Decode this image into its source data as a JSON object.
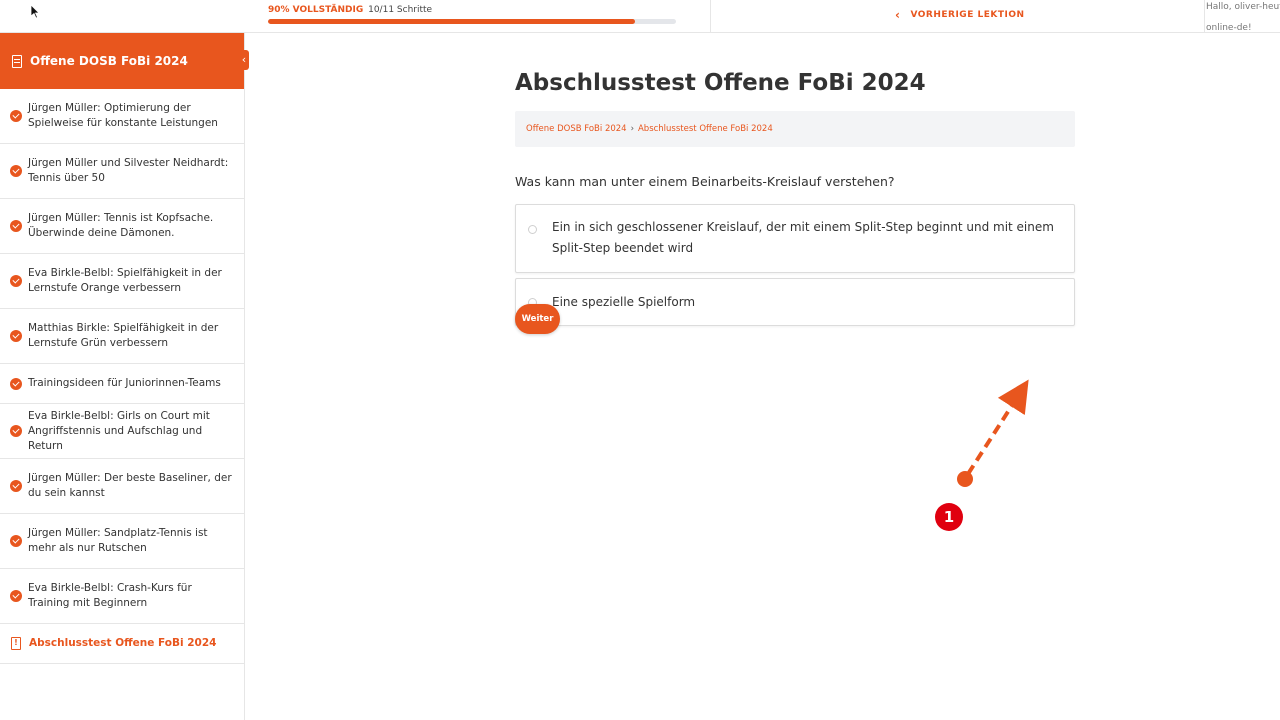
{
  "topbar": {
    "progress_percent_label": "90% VOLLSTÄNDIG",
    "progress_steps_label": "10/11 Schritte",
    "progress_fraction": 0.9,
    "prev_lesson_label": "VORHERIGE LEKTION",
    "greeting": "Hallo, oliver-heuft",
    "greeting_domain": "online-de!"
  },
  "sidebar": {
    "course_title": "Offene DOSB FoBi 2024",
    "lessons": [
      {
        "label": "Jürgen Müller: Optimierung der Spielweise für konstante Leistungen"
      },
      {
        "label": "Jürgen Müller und Silvester Neidhardt: Tennis über 50"
      },
      {
        "label": "Jürgen Müller: Tennis ist Kopfsache. Überwinde deine Dämonen."
      },
      {
        "label": "Eva Birkle-Belbl: Spielfähigkeit in der Lernstufe Orange verbessern"
      },
      {
        "label": "Matthias Birkle: Spielfähigkeit in der Lernstufe Grün verbessern"
      },
      {
        "label": "Trainingsideen für Juniorinnen-Teams"
      },
      {
        "label": "Eva Birkle-Belbl: Girls on Court mit Angriffstennis und Aufschlag und Return"
      },
      {
        "label": "Jürgen Müller: Der beste Baseliner, der du sein kannst"
      },
      {
        "label": "Jürgen Müller: Sandplatz-Tennis ist mehr als nur Rutschen"
      },
      {
        "label": "Eva Birkle-Belbl: Crash-Kurs für Training mit Beginnern"
      },
      {
        "label": "Abschlusstest Offene FoBi 2024"
      }
    ]
  },
  "main": {
    "title": "Abschlusstest Offene FoBi 2024",
    "breadcrumb": [
      "Offene DOSB FoBi 2024",
      "›",
      "Abschlusstest Offene FoBi 2024"
    ],
    "question": "Was kann man unter einem Beinarbeits-Kreislauf verstehen?",
    "answers": [
      "Ein in sich geschlossener Kreislauf, der mit einem Split-Step beginnt und mit einem Split-Step beendet wird",
      "Eine spezielle Spielform"
    ],
    "next_button": "Weiter"
  },
  "annotation": {
    "step_number": "1",
    "arrow_color": "#e8561e",
    "badge_color": "#e0000f"
  },
  "colors": {
    "accent": "#e8561e"
  }
}
